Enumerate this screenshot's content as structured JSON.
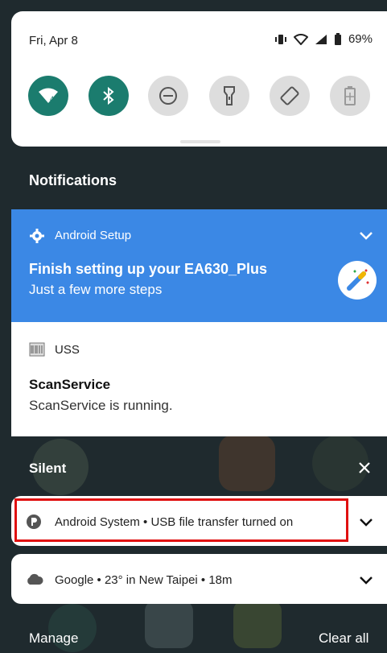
{
  "quick_settings": {
    "date": "Fri, Apr 8",
    "battery": "69%",
    "tiles": [
      {
        "name": "wifi-tile",
        "icon": "wifi-icon",
        "state": "on"
      },
      {
        "name": "bluetooth-tile",
        "icon": "bluetooth-icon",
        "state": "on"
      },
      {
        "name": "dnd-tile",
        "icon": "do-not-disturb-icon",
        "state": "off"
      },
      {
        "name": "flashlight-tile",
        "icon": "flashlight-icon",
        "state": "off"
      },
      {
        "name": "autorotate-tile",
        "icon": "rotate-icon",
        "state": "off"
      },
      {
        "name": "battery-saver-tile",
        "icon": "battery-saver-icon",
        "state": "off"
      }
    ],
    "accent": "#1b7c6e"
  },
  "notifications_header": "Notifications",
  "setup": {
    "app": "Android Setup",
    "title": "Finish setting up your EA630_Plus",
    "text": "Just a few more steps",
    "color": "#3b88e5"
  },
  "uss": {
    "app": "USS",
    "title": "ScanService",
    "text": "ScanService is running."
  },
  "silent_header": "Silent",
  "silent": [
    {
      "text": "Android System • USB file transfer turned on"
    },
    {
      "text": "Google • 23° in New Taipei • 18m"
    }
  ],
  "footer": {
    "manage": "Manage",
    "clear_all": "Clear all"
  }
}
